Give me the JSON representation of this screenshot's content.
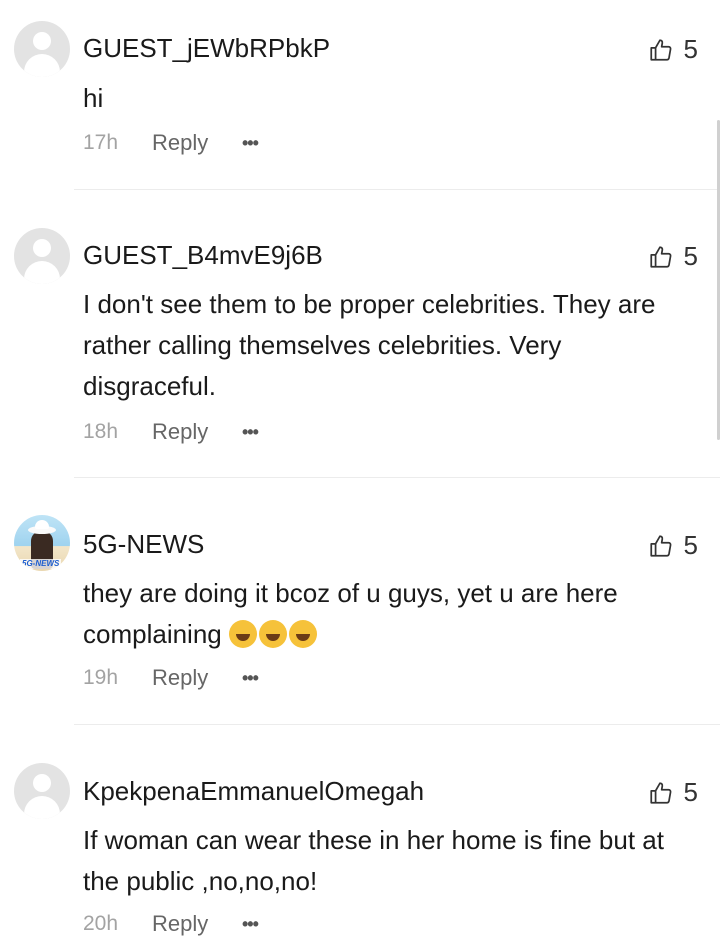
{
  "comments": [
    {
      "username": "GUEST_jEWbRPbkP",
      "text": "hi",
      "time": "17h",
      "reply_label": "Reply",
      "more_label": "•••",
      "likes": "5",
      "avatar": "default-avatar-icon"
    },
    {
      "username": "GUEST_B4mvE9j6B",
      "text": "I don't see them to be proper celebrities. They are rather calling themselves celebrities. Very disgraceful.",
      "time": "18h",
      "reply_label": "Reply",
      "more_label": "•••",
      "likes": "5",
      "avatar": "default-avatar-icon"
    },
    {
      "username": "5G-NEWS",
      "text": "they are doing it bcoz of u guys, yet u are here complaining",
      "emojis": [
        "rolling-on-floor-laughing-emoji",
        "rolling-on-floor-laughing-emoji",
        "rolling-on-floor-laughing-emoji"
      ],
      "time": "19h",
      "reply_label": "Reply",
      "more_label": "•••",
      "likes": "5",
      "avatar": "profile-photo",
      "avatar_tag": "5G-NEWS"
    },
    {
      "username": "KpekpenaEmmanuelOmegah",
      "text": "If woman can wear these in her home is fine but at the public ,no,no,no!",
      "time": "20h",
      "reply_label": "Reply",
      "more_label": "•••",
      "likes": "5",
      "avatar": "default-avatar-icon"
    }
  ]
}
